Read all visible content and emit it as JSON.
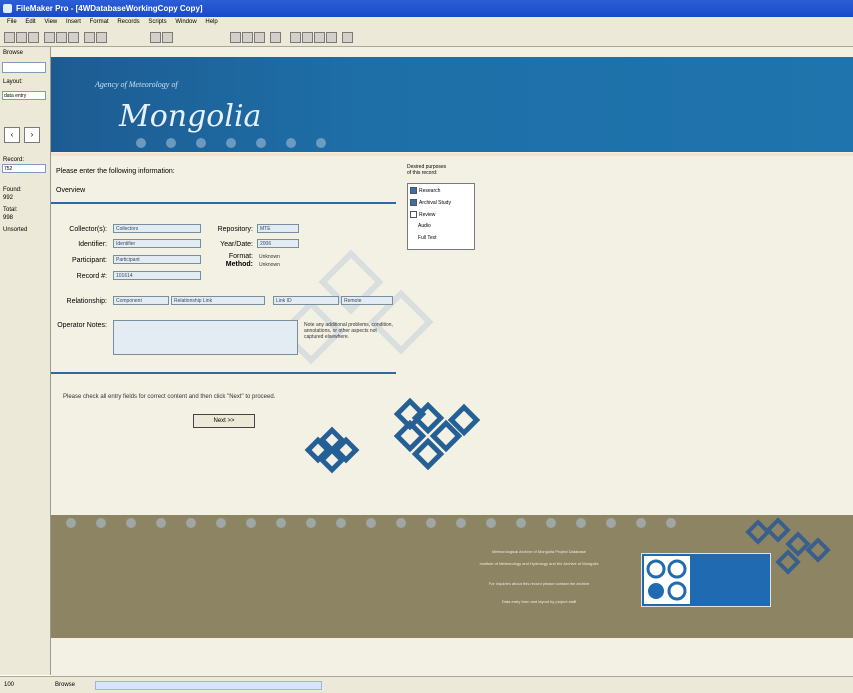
{
  "window": {
    "title": "FileMaker Pro - [4WDatabaseWorkingCopy Copy]"
  },
  "menu": [
    "File",
    "Edit",
    "View",
    "Insert",
    "Format",
    "Records",
    "Scripts",
    "Window",
    "Help"
  ],
  "left_panel": {
    "browse_label": "Browse",
    "layout_label": "Layout:",
    "layout_value": "data entry",
    "record_label": "Record:",
    "record_value": "752",
    "found_label": "Found:",
    "found_value": "992",
    "total_label": "Total:",
    "total_value": "998",
    "sort_label": "Unsorted"
  },
  "banner": {
    "org": "Agency of Meteorology of",
    "brand": "Mongolia"
  },
  "form": {
    "intro": "Please enter the following information:",
    "section_title": "Overview",
    "fields": {
      "collectors_label": "Collector(s):",
      "collectors_value": "Collectors",
      "identifier_label": "Identifier:",
      "identifier_value": "Identifier",
      "participant_label": "Participant:",
      "participant_value": "Participant",
      "record_num_label": "Record #:",
      "record_num_value": "101614",
      "repository_label": "Repository:",
      "repository_value": "MTE",
      "year_label": "Year/Date:",
      "year_value": "2006",
      "format_label": "Format:",
      "format_value": "Unknown",
      "method_label": "Method:",
      "method_value": "Unknown",
      "relationship_label": "Relationship:",
      "relationship_value_a": "Component",
      "relationship_value_b": "Relationship Link",
      "relationship_value_c": "Link ID",
      "relationship_value_d": "Remote",
      "operator_label": "Operator Notes:",
      "operator_note": "Note any additional problems, condition, annotations, or other aspects not captured elsewhere."
    },
    "next_prompt": "Please check all entry fields for correct content and then click \"Next\" to proceed.",
    "next_button": "Next >>"
  },
  "purpose_list": {
    "title_line1": "Desired purposes",
    "title_line2": "of this record:",
    "items": [
      {
        "label": "Research",
        "checked": true
      },
      {
        "label": "Archival Study",
        "checked": true
      },
      {
        "label": "Review",
        "checked": false
      },
      {
        "label": "Audio",
        "checked": false
      },
      {
        "label": "Full Text",
        "checked": false
      }
    ]
  },
  "footer": {
    "line1": "Meteorological Archive of Mongolia Project Database",
    "line2": "Institute of Meteorology and Hydrology and the Archive of Mongolia",
    "line3": "For inquiries about this record please contact the archive",
    "line4": "Data entry form and layout by project staff"
  },
  "statusbar": {
    "zoom": "100",
    "mode": "Browse"
  },
  "colors": {
    "banner": "#1e6fa8",
    "divider": "#2e69a3",
    "footer": "#8c8462",
    "knot": "#245f95"
  }
}
